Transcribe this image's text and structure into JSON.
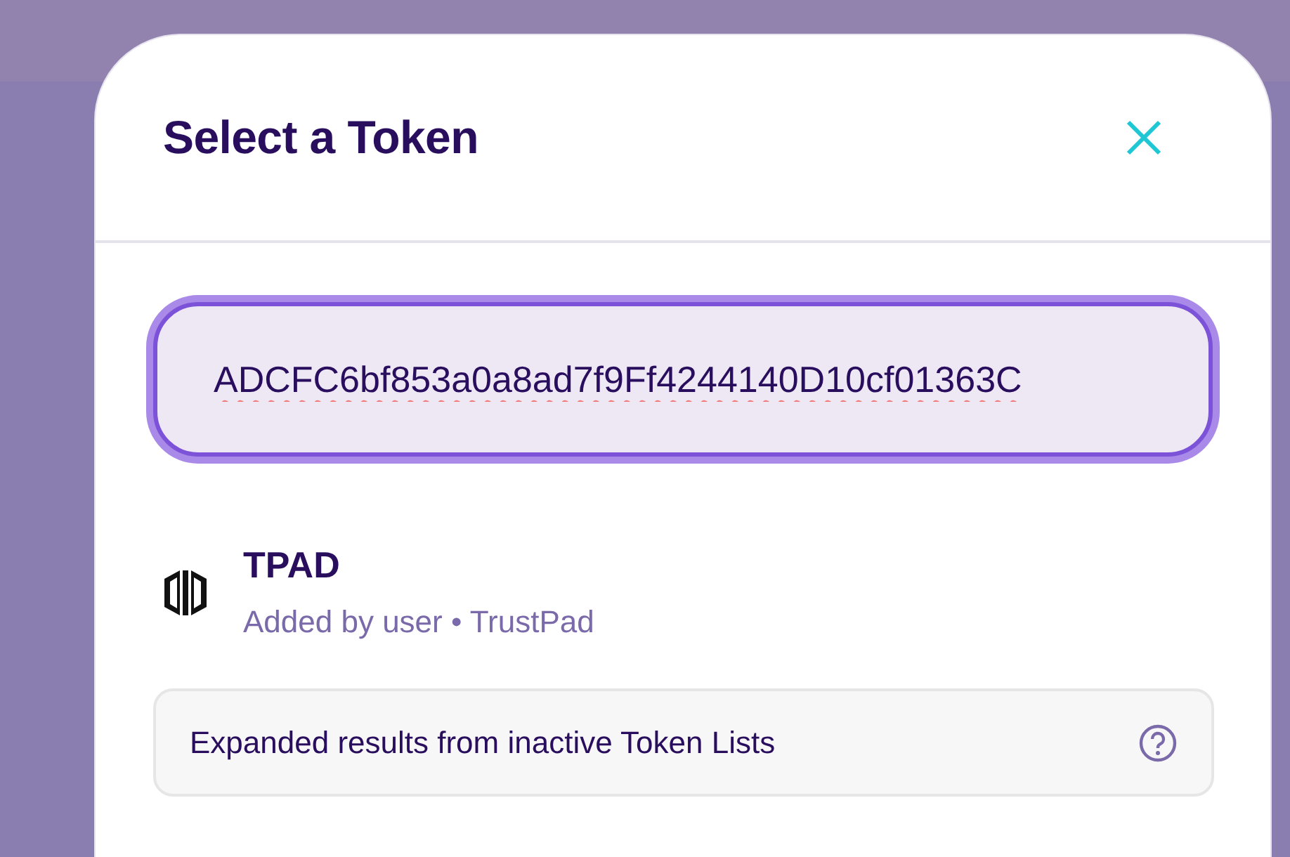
{
  "dialog": {
    "title": "Select a Token"
  },
  "search": {
    "value": "ADCFC6bf853a0a8ad7f9Ff4244140D10cf01363C",
    "focused": true
  },
  "tokens": [
    {
      "symbol": "TPAD",
      "source": "Added by user • TrustPad"
    }
  ],
  "notice": {
    "text": "Expanded results from inactive Token Lists"
  }
}
